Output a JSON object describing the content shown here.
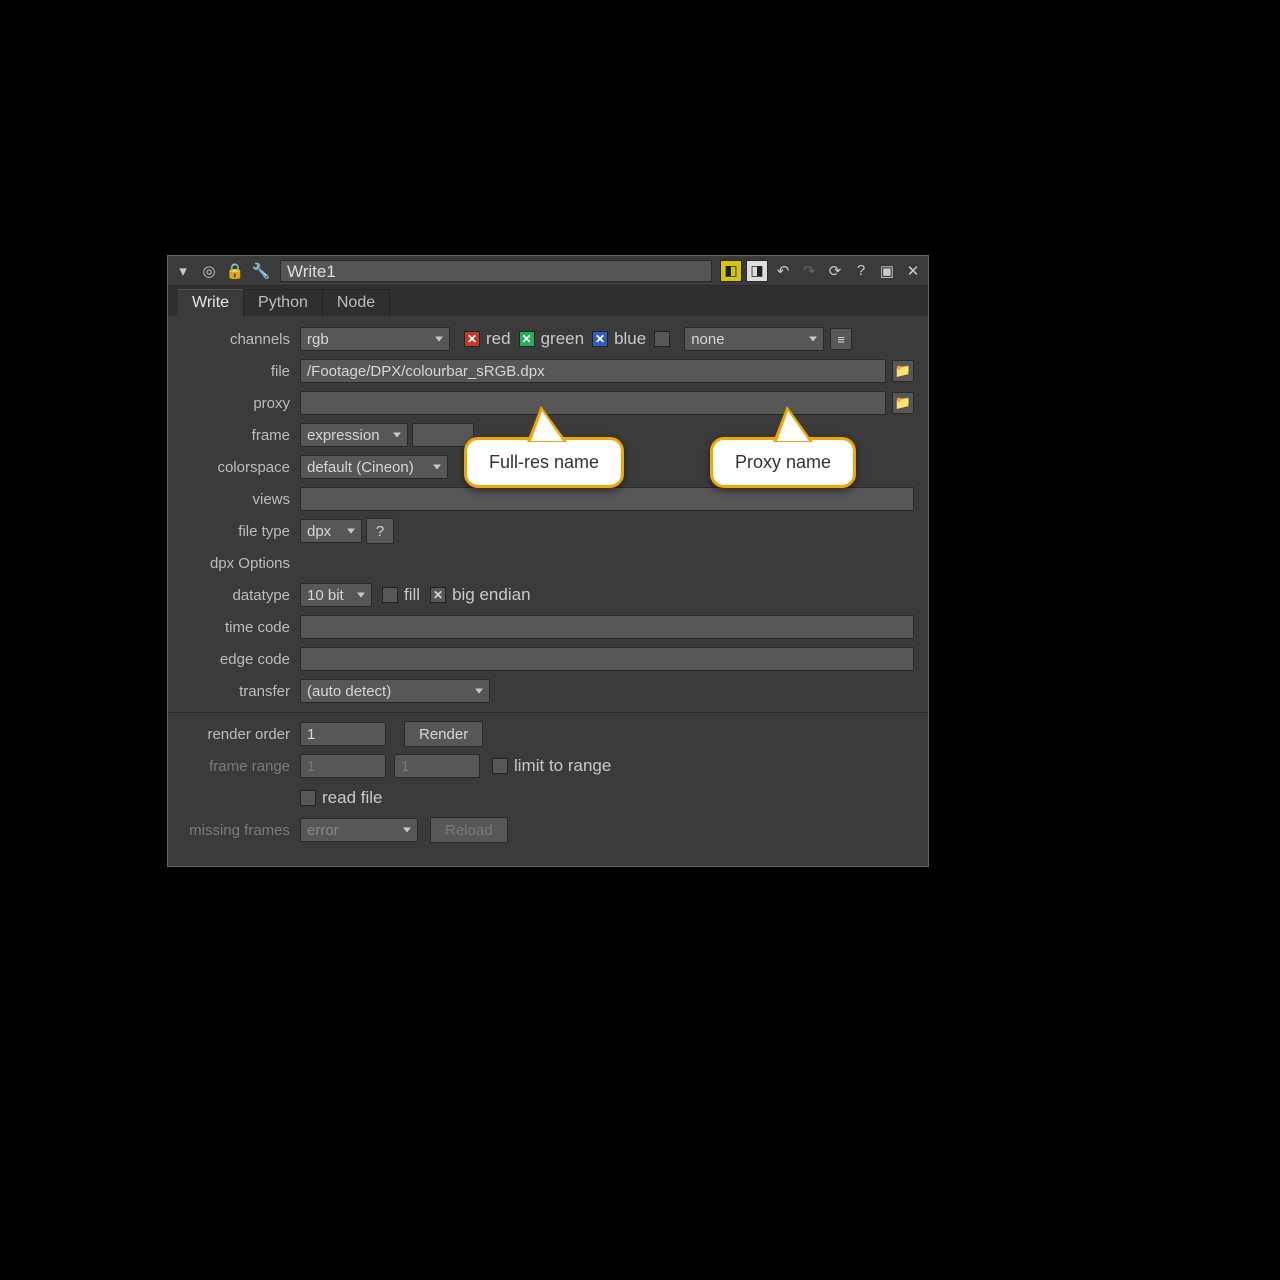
{
  "titlebar": {
    "node_name": "Write1"
  },
  "tabs": {
    "write": "Write",
    "python": "Python",
    "node": "Node"
  },
  "labels": {
    "channels": "channels",
    "file": "file",
    "proxy": "proxy",
    "frame": "frame",
    "colorspace": "colorspace",
    "views": "views",
    "file_type": "file type",
    "dpx_options": "dpx Options",
    "datatype": "datatype",
    "time_code": "time code",
    "edge_code": "edge code",
    "transfer": "transfer",
    "render_order": "render order",
    "frame_range": "frame range",
    "missing_frames": "missing frames",
    "red": "red",
    "green": "green",
    "blue": "blue",
    "fill": "fill",
    "big_endian": "big endian",
    "limit_to_range": "limit to range",
    "read_file": "read file"
  },
  "values": {
    "channels": "rgb",
    "channels_extra": "none",
    "file": "/Footage/DPX/colourbar_sRGB.dpx",
    "proxy": "",
    "frame": "expression",
    "colorspace": "default (Cineon)",
    "views": "",
    "file_type": "dpx",
    "help": "?",
    "datatype": "10 bit",
    "time_code": "",
    "edge_code": "",
    "transfer": "(auto detect)",
    "render_order": "1",
    "frame_range_start": "1",
    "frame_range_end": "1",
    "missing_frames": "error"
  },
  "buttons": {
    "render": "Render",
    "reload": "Reload"
  },
  "callouts": {
    "fullres": "Full-res name",
    "proxy": "Proxy name"
  }
}
